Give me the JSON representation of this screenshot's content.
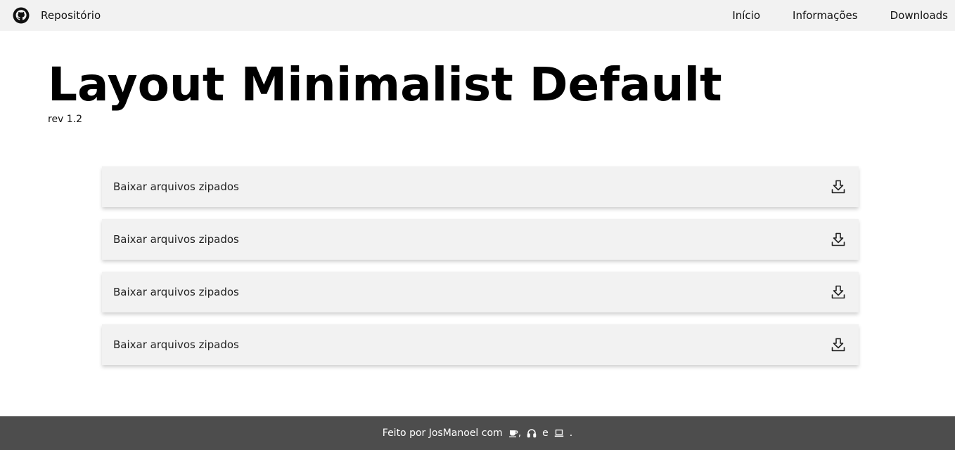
{
  "header": {
    "brand_label": "Repositório",
    "nav": [
      {
        "label": "Início"
      },
      {
        "label": "Informações"
      },
      {
        "label": "Downloads"
      }
    ]
  },
  "hero": {
    "title": "Layout Minimalist Default",
    "revision": "rev 1.2"
  },
  "downloads": [
    {
      "label": "Baixar arquivos zipados",
      "icon": "download-icon"
    },
    {
      "label": "Baixar arquivos zipados",
      "icon": "download-icon"
    },
    {
      "label": "Baixar arquivos zipados",
      "icon": "download-icon"
    },
    {
      "label": "Baixar arquivos zipados",
      "icon": "download-icon"
    }
  ],
  "footer": {
    "prefix": "Feito por JosManoel com",
    "comma": ",",
    "and": "e",
    "end": ".",
    "icons": [
      "coffee-icon",
      "headphones-icon",
      "laptop-icon"
    ]
  },
  "colors": {
    "topbar_bg": "#f2f2f2",
    "card_bg": "#f2f2f2",
    "footer_bg": "#4d4d4d"
  }
}
